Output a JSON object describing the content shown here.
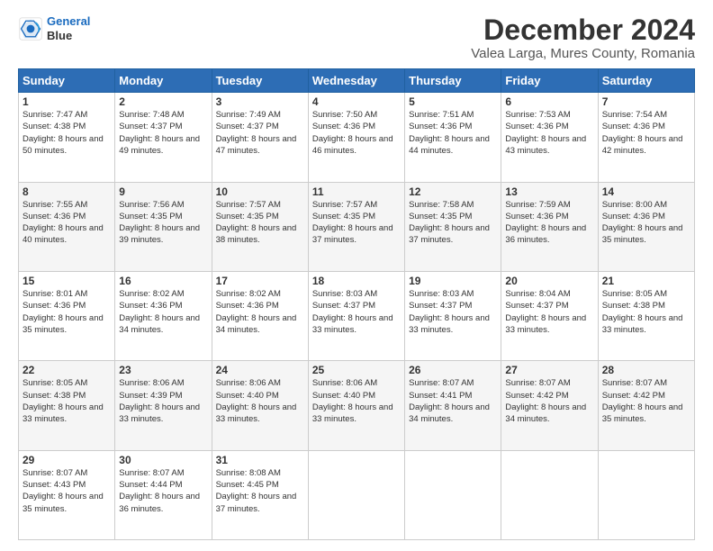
{
  "logo": {
    "line1": "General",
    "line2": "Blue"
  },
  "title": "December 2024",
  "subtitle": "Valea Larga, Mures County, Romania",
  "days_header": [
    "Sunday",
    "Monday",
    "Tuesday",
    "Wednesday",
    "Thursday",
    "Friday",
    "Saturday"
  ],
  "weeks": [
    [
      {
        "day": "1",
        "rise": "Sunrise: 7:47 AM",
        "set": "Sunset: 4:38 PM",
        "daylight": "Daylight: 8 hours and 50 minutes."
      },
      {
        "day": "2",
        "rise": "Sunrise: 7:48 AM",
        "set": "Sunset: 4:37 PM",
        "daylight": "Daylight: 8 hours and 49 minutes."
      },
      {
        "day": "3",
        "rise": "Sunrise: 7:49 AM",
        "set": "Sunset: 4:37 PM",
        "daylight": "Daylight: 8 hours and 47 minutes."
      },
      {
        "day": "4",
        "rise": "Sunrise: 7:50 AM",
        "set": "Sunset: 4:36 PM",
        "daylight": "Daylight: 8 hours and 46 minutes."
      },
      {
        "day": "5",
        "rise": "Sunrise: 7:51 AM",
        "set": "Sunset: 4:36 PM",
        "daylight": "Daylight: 8 hours and 44 minutes."
      },
      {
        "day": "6",
        "rise": "Sunrise: 7:53 AM",
        "set": "Sunset: 4:36 PM",
        "daylight": "Daylight: 8 hours and 43 minutes."
      },
      {
        "day": "7",
        "rise": "Sunrise: 7:54 AM",
        "set": "Sunset: 4:36 PM",
        "daylight": "Daylight: 8 hours and 42 minutes."
      }
    ],
    [
      {
        "day": "8",
        "rise": "Sunrise: 7:55 AM",
        "set": "Sunset: 4:36 PM",
        "daylight": "Daylight: 8 hours and 40 minutes."
      },
      {
        "day": "9",
        "rise": "Sunrise: 7:56 AM",
        "set": "Sunset: 4:35 PM",
        "daylight": "Daylight: 8 hours and 39 minutes."
      },
      {
        "day": "10",
        "rise": "Sunrise: 7:57 AM",
        "set": "Sunset: 4:35 PM",
        "daylight": "Daylight: 8 hours and 38 minutes."
      },
      {
        "day": "11",
        "rise": "Sunrise: 7:57 AM",
        "set": "Sunset: 4:35 PM",
        "daylight": "Daylight: 8 hours and 37 minutes."
      },
      {
        "day": "12",
        "rise": "Sunrise: 7:58 AM",
        "set": "Sunset: 4:35 PM",
        "daylight": "Daylight: 8 hours and 37 minutes."
      },
      {
        "day": "13",
        "rise": "Sunrise: 7:59 AM",
        "set": "Sunset: 4:36 PM",
        "daylight": "Daylight: 8 hours and 36 minutes."
      },
      {
        "day": "14",
        "rise": "Sunrise: 8:00 AM",
        "set": "Sunset: 4:36 PM",
        "daylight": "Daylight: 8 hours and 35 minutes."
      }
    ],
    [
      {
        "day": "15",
        "rise": "Sunrise: 8:01 AM",
        "set": "Sunset: 4:36 PM",
        "daylight": "Daylight: 8 hours and 35 minutes."
      },
      {
        "day": "16",
        "rise": "Sunrise: 8:02 AM",
        "set": "Sunset: 4:36 PM",
        "daylight": "Daylight: 8 hours and 34 minutes."
      },
      {
        "day": "17",
        "rise": "Sunrise: 8:02 AM",
        "set": "Sunset: 4:36 PM",
        "daylight": "Daylight: 8 hours and 34 minutes."
      },
      {
        "day": "18",
        "rise": "Sunrise: 8:03 AM",
        "set": "Sunset: 4:37 PM",
        "daylight": "Daylight: 8 hours and 33 minutes."
      },
      {
        "day": "19",
        "rise": "Sunrise: 8:03 AM",
        "set": "Sunset: 4:37 PM",
        "daylight": "Daylight: 8 hours and 33 minutes."
      },
      {
        "day": "20",
        "rise": "Sunrise: 8:04 AM",
        "set": "Sunset: 4:37 PM",
        "daylight": "Daylight: 8 hours and 33 minutes."
      },
      {
        "day": "21",
        "rise": "Sunrise: 8:05 AM",
        "set": "Sunset: 4:38 PM",
        "daylight": "Daylight: 8 hours and 33 minutes."
      }
    ],
    [
      {
        "day": "22",
        "rise": "Sunrise: 8:05 AM",
        "set": "Sunset: 4:38 PM",
        "daylight": "Daylight: 8 hours and 33 minutes."
      },
      {
        "day": "23",
        "rise": "Sunrise: 8:06 AM",
        "set": "Sunset: 4:39 PM",
        "daylight": "Daylight: 8 hours and 33 minutes."
      },
      {
        "day": "24",
        "rise": "Sunrise: 8:06 AM",
        "set": "Sunset: 4:40 PM",
        "daylight": "Daylight: 8 hours and 33 minutes."
      },
      {
        "day": "25",
        "rise": "Sunrise: 8:06 AM",
        "set": "Sunset: 4:40 PM",
        "daylight": "Daylight: 8 hours and 33 minutes."
      },
      {
        "day": "26",
        "rise": "Sunrise: 8:07 AM",
        "set": "Sunset: 4:41 PM",
        "daylight": "Daylight: 8 hours and 34 minutes."
      },
      {
        "day": "27",
        "rise": "Sunrise: 8:07 AM",
        "set": "Sunset: 4:42 PM",
        "daylight": "Daylight: 8 hours and 34 minutes."
      },
      {
        "day": "28",
        "rise": "Sunrise: 8:07 AM",
        "set": "Sunset: 4:42 PM",
        "daylight": "Daylight: 8 hours and 35 minutes."
      }
    ],
    [
      {
        "day": "29",
        "rise": "Sunrise: 8:07 AM",
        "set": "Sunset: 4:43 PM",
        "daylight": "Daylight: 8 hours and 35 minutes."
      },
      {
        "day": "30",
        "rise": "Sunrise: 8:07 AM",
        "set": "Sunset: 4:44 PM",
        "daylight": "Daylight: 8 hours and 36 minutes."
      },
      {
        "day": "31",
        "rise": "Sunrise: 8:08 AM",
        "set": "Sunset: 4:45 PM",
        "daylight": "Daylight: 8 hours and 37 minutes."
      },
      null,
      null,
      null,
      null
    ]
  ]
}
